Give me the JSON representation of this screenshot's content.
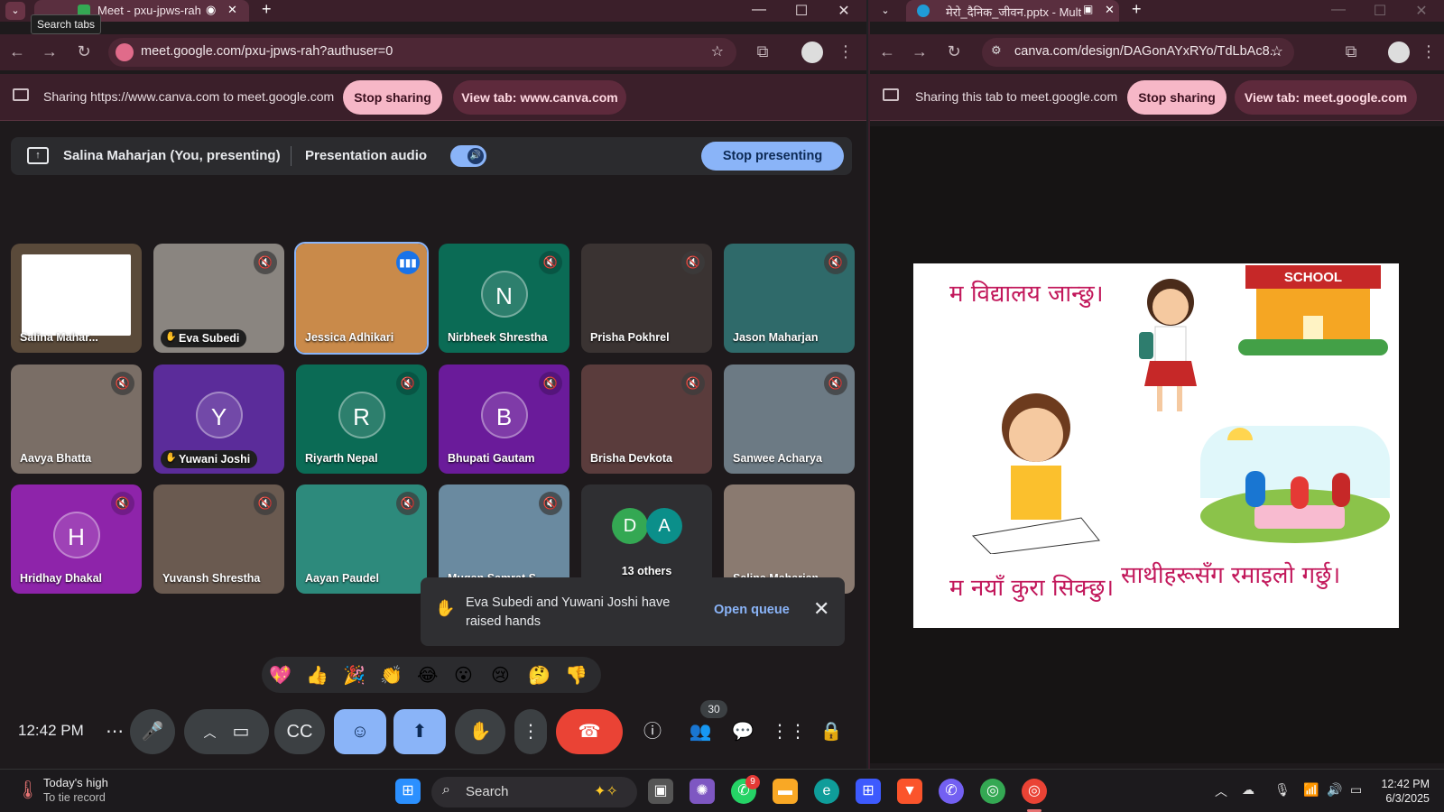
{
  "left_window": {
    "tab_title": "Meet - pxu-jpws-rah",
    "tooltip": "Search tabs",
    "url": "meet.google.com/pxu-jpws-rah?authuser=0",
    "share_text": "Sharing https://www.canva.com to meet.google.com",
    "stop_sharing": "Stop sharing",
    "view_tab": "View tab: www.canva.com"
  },
  "meet": {
    "presenter_label": "Salina Maharjan (You, presenting)",
    "presentation_audio": "Presentation audio",
    "stop_presenting": "Stop presenting",
    "participants": [
      {
        "name": "Salina Mahar...",
        "type": "slide"
      },
      {
        "name": "Eva Subedi",
        "type": "video",
        "hand": true
      },
      {
        "name": "Jessica Adhikari",
        "type": "video",
        "speaking": true
      },
      {
        "name": "Nirbheek Shrestha",
        "type": "avatar",
        "initial": "N",
        "color": "#0b6b55"
      },
      {
        "name": "Prisha Pokhrel",
        "type": "video"
      },
      {
        "name": "Jason Maharjan",
        "type": "video"
      },
      {
        "name": "Aavya Bhatta",
        "type": "video"
      },
      {
        "name": "Yuwani Joshi",
        "type": "avatar",
        "initial": "Y",
        "color": "#5b2c9a",
        "hand": true
      },
      {
        "name": "Riyarth Nepal",
        "type": "avatar",
        "initial": "R",
        "color": "#0b6b55"
      },
      {
        "name": "Bhupati Gautam",
        "type": "avatar",
        "initial": "B",
        "color": "#6a1b9a"
      },
      {
        "name": "Brisha Devkota",
        "type": "video"
      },
      {
        "name": "Sanwee Acharya",
        "type": "video"
      },
      {
        "name": "Hridhay Dhakal",
        "type": "avatar",
        "initial": "H",
        "color": "#8e24aa"
      },
      {
        "name": "Yuvansh Shrestha",
        "type": "video"
      },
      {
        "name": "Aayan Paudel",
        "type": "video"
      },
      {
        "name": "Mugan Samrat S...",
        "type": "video"
      },
      {
        "name": "13 others",
        "type": "others",
        "initials": [
          "D",
          "A"
        ]
      },
      {
        "name": "Salina Maharjan",
        "type": "video"
      }
    ],
    "raised_hands_msg": "Eva Subedi and Yuwani Joshi have raised hands",
    "open_queue": "Open queue",
    "emojis": [
      "💖",
      "👍",
      "🎉",
      "👏",
      "😂",
      "😮",
      "😢",
      "🤔",
      "👎"
    ],
    "clock": "12:42 PM",
    "participant_count": "30"
  },
  "right_window": {
    "tab_title": "मेरो_दैनिक_जीवन.pptx - Mult",
    "url": "canva.com/design/DAGonAYxRYo/TdLbAc8...",
    "share_text": "Sharing this tab to meet.google.com",
    "stop_sharing": "Stop sharing",
    "view_tab": "View tab: meet.google.com"
  },
  "slide": {
    "line1": "म विद्यालय जान्छु।",
    "school_sign": "SCHOOL",
    "line2": "म नयाँ कुरा सिक्छु।",
    "line3": "साथीहरूसँग रमाइलो गर्छु।"
  },
  "taskbar": {
    "weather_title": "Today's high",
    "weather_sub": "To tie record",
    "search": "Search",
    "whatsapp_badge": "9",
    "time": "12:42 PM",
    "date": "6/3/2025"
  },
  "colors": {
    "accent_blue": "#8ab4f8",
    "leave_red": "#ea4335",
    "chrome_titlebar": "#3b1f2a",
    "slide_text": "#c2185b"
  }
}
